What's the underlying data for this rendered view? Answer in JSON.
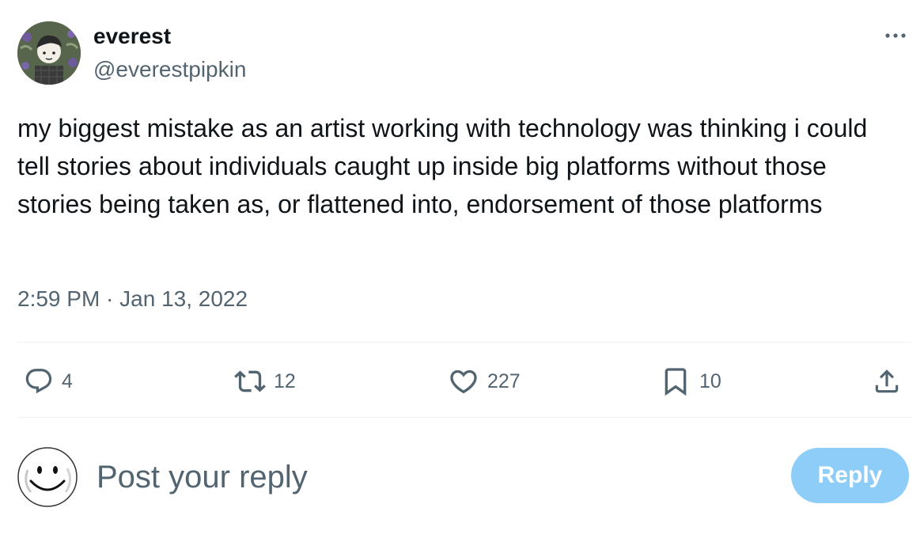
{
  "author": {
    "display_name": "everest",
    "handle": "@everestpipkin"
  },
  "tweet": {
    "text": "my biggest mistake as an artist working with technology was thinking i could tell stories about individuals caught up inside big platforms without those stories being taken as, or flattened into, endorsement of those platforms",
    "timestamp": "2:59 PM · Jan 13, 2022"
  },
  "actions": {
    "replies": "4",
    "reposts": "12",
    "likes": "227",
    "bookmarks": "10"
  },
  "icons": {
    "more": "more-icon",
    "reply": "reply-icon",
    "repost": "repost-icon",
    "like": "heart-icon",
    "bookmark": "bookmark-icon",
    "share": "share-icon"
  },
  "composer": {
    "placeholder": "Post your reply",
    "button_label": "Reply"
  },
  "colors": {
    "text": "#0f1419",
    "secondary": "#536471",
    "divider": "#eff3f4",
    "reply_button": "#8ecdf8"
  }
}
